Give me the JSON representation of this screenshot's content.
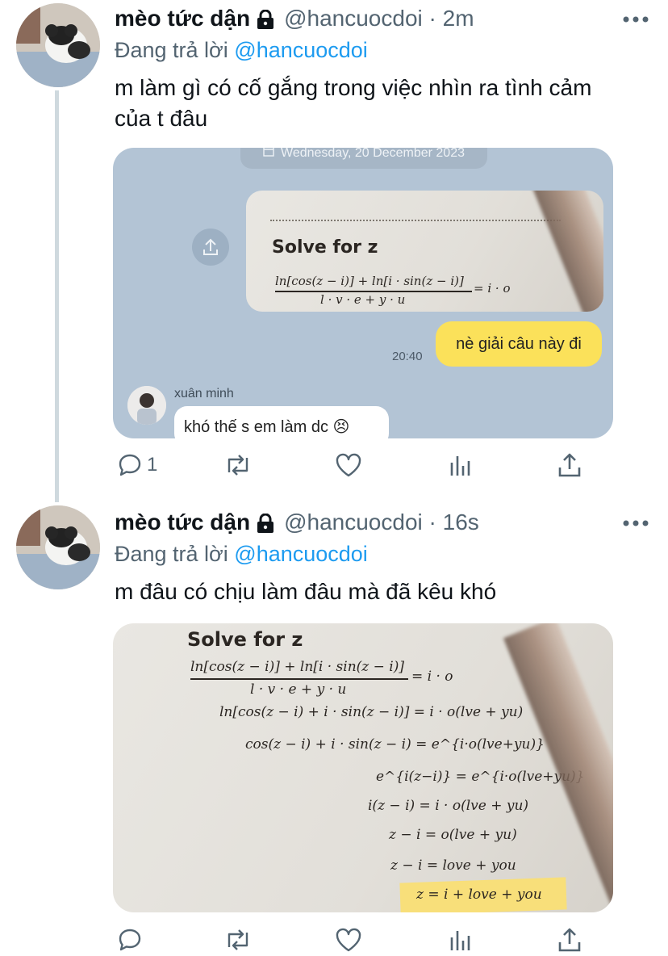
{
  "tweets": [
    {
      "display_name": "mèo tức dận",
      "handle": "@hancuocdoi · 2m",
      "reply_prefix": "Đang trả lời",
      "reply_mention": "@hancuocdoi",
      "text_line1": "m làm gì có cố gắng trong việc nhìn ra tình cảm",
      "text_line2": "của t đâu",
      "reply_count": "1",
      "chat": {
        "date": "Wednesday, 20 December 2023",
        "outgoing_message": "nè giải câu này đi",
        "time": "20:40",
        "sender_name": "xuân minh",
        "incoming_message": "khó thế s em làm dc 😣"
      }
    },
    {
      "display_name": "mèo tức dận",
      "handle": "@hancuocdoi · 16s",
      "reply_prefix": "Đang trả lời",
      "reply_mention": "@hancuocdoi",
      "text": "m đâu có chịu làm đâu mà đã kêu khó"
    }
  ],
  "math": {
    "title": "Solve for z",
    "numerator": "ln[cos(z − i)] + ln[i · sin(z − i)]",
    "denominator": "l · v · e + y · u",
    "rhs": "= i · o",
    "steps": [
      "ln[cos(z − i) + i · sin(z − i)] = i · o(lve + yu)",
      "cos(z − i) + i · sin(z − i) = e^{i·o(lve+yu)}",
      "e^{i(z−i)} = e^{i·o(lve+yu)}",
      "i(z − i) = i · o(lve + yu)",
      "z − i = o(lve + yu)",
      "z − i = love + you",
      "z = i + love + you"
    ]
  },
  "icons": {
    "lock": "lock-icon",
    "more": "more-icon",
    "reply": "reply-icon",
    "retweet": "retweet-icon",
    "like": "like-icon",
    "views": "views-icon",
    "share": "share-icon"
  },
  "colors": {
    "text": "#0f1419",
    "secondary": "#536471",
    "link": "#1d9bf0",
    "chat_bg": "#b3c4d5",
    "outgoing_bubble": "#fbe15a"
  }
}
